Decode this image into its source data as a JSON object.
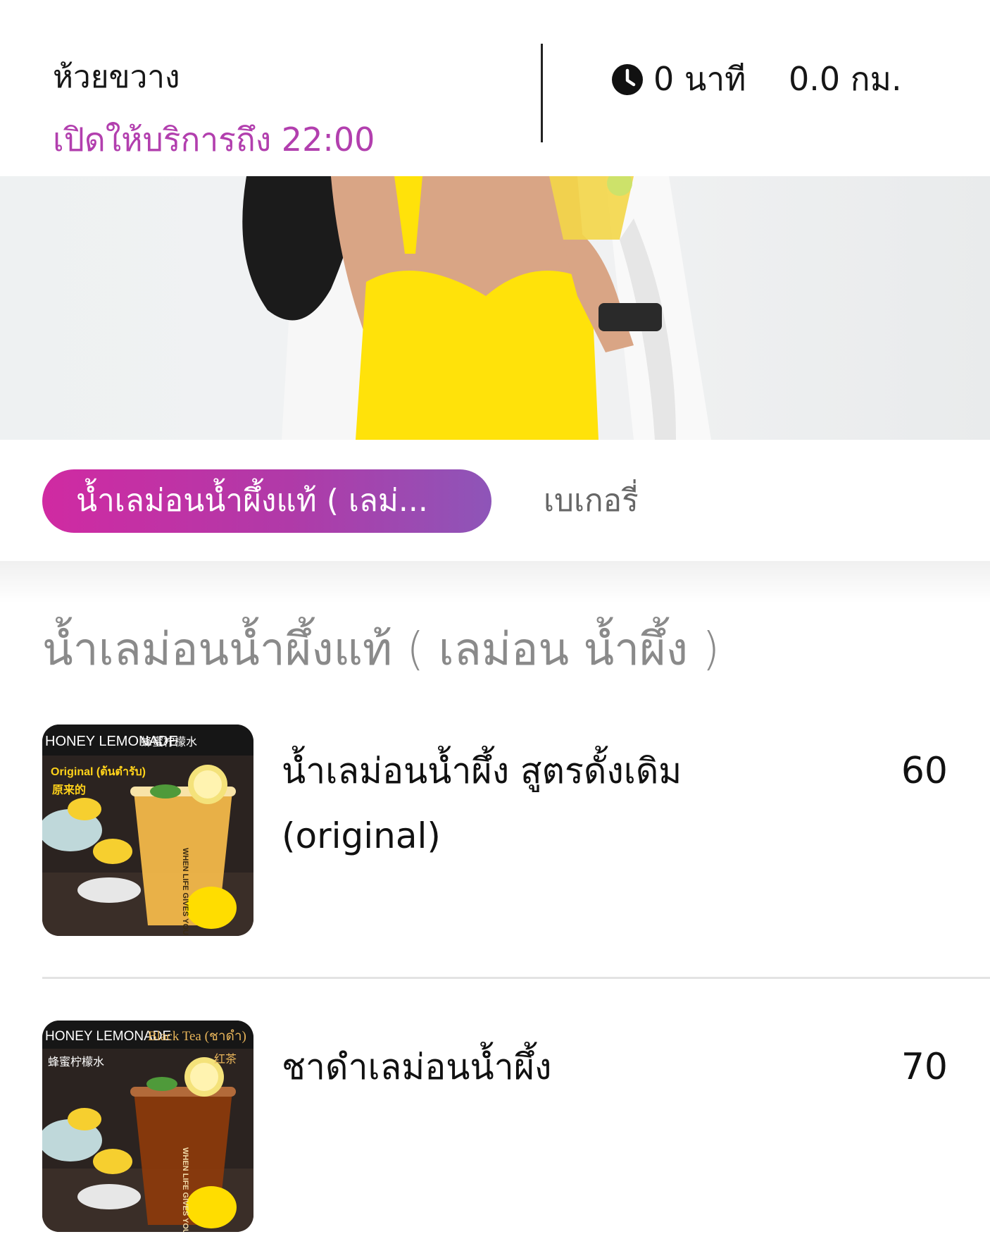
{
  "store": {
    "name": "ห้วยขวาง",
    "open_hours": "เปิดให้บริการถึง 22:00",
    "eta": "0 นาที",
    "distance": "0.0 กม.",
    "accent_color": "#b23fae"
  },
  "icons": {
    "clock": "clock-icon"
  },
  "tabs": [
    {
      "label": "น้ำเลม่อนน้ำผึ้งแท้ ( เลม่...",
      "active": true
    },
    {
      "label": "เบเกอรี่",
      "active": false
    }
  ],
  "section": {
    "title": "น้ำเลม่อนน้ำผึ้งแท้ ( เลม่อน น้ำผึ้ง )"
  },
  "items": [
    {
      "name": "น้ำเลม่อนน้ำผึ้ง สูตรดั้งเดิม (original)",
      "price": "60",
      "image_text": {
        "brand": "HONEY LEMONADE",
        "cn": "蜂蜜柠檬水",
        "variant": "Original (ต้นตำรับ)",
        "variant_cn": "原来的",
        "cup_text": "WHEN LIFE GIVES YOU LEMONS"
      }
    },
    {
      "name": "ชาดำเลม่อนน้ำผึ้ง",
      "price": "70",
      "image_text": {
        "brand": "HONEY LEMONADE",
        "cn": "蜂蜜柠檬水",
        "variant": "Black Tea (ชาดำ)",
        "variant_cn": "红茶",
        "cup_text": "WHEN LIFE GIVES YOU LEMONS"
      }
    }
  ]
}
